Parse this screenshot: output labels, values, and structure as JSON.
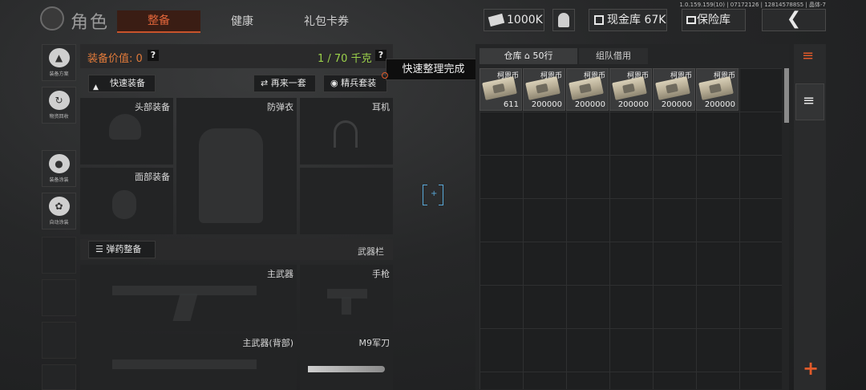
{
  "version_text": "1.0.159.159(10) | 07172126 | 128145788S5 | 晶体-7",
  "header": {
    "title": "角色",
    "tabs": [
      "整备",
      "健康",
      "礼包卡券"
    ],
    "currency_amount": "1000K",
    "cash_vault": "现金库 67K",
    "safe": "保险库",
    "back_icon": "chevron-left-icon"
  },
  "sidebar": {
    "items": [
      {
        "label": "装备方案",
        "icon": "helmet-icon"
      },
      {
        "label": "物资回收",
        "icon": "recycle-icon"
      },
      {
        "label": "装备涂装",
        "icon": "paint-icon"
      },
      {
        "label": "自动涂装",
        "icon": "spray-icon"
      }
    ]
  },
  "equipment": {
    "value_label": "装备价值: 0",
    "weight_label": "1 / 70 千克",
    "help": "?",
    "quick_equip": "快速装备",
    "repeat": "再来一套",
    "elite": "精兵套装",
    "ammo": "弹药整备",
    "weapon_bar": "武器栏",
    "slots": {
      "head": "头部装备",
      "armor": "防弹衣",
      "earphone": "耳机",
      "face": "面部装备",
      "primary": "主武器",
      "pistol": "手枪",
      "primary_back": "主武器(背部)",
      "knife": "M9军刀"
    }
  },
  "tooltip": "快速整理完成",
  "warehouse": {
    "tab_active": "仓库",
    "tab_rows": "50行",
    "tab_team": "组队借用",
    "items": [
      {
        "name": "柯恩币",
        "count": "611"
      },
      {
        "name": "柯恩币",
        "count": "200000"
      },
      {
        "name": "柯恩币",
        "count": "200000"
      },
      {
        "name": "柯恩币",
        "count": "200000"
      },
      {
        "name": "柯恩币",
        "count": "200000"
      },
      {
        "name": "柯恩币",
        "count": "200000"
      }
    ]
  },
  "right_column": {
    "add": "+"
  },
  "colors": {
    "accent": "#e0653a",
    "weight_green": "#9bd14a",
    "bracket_blue": "#58a8d8"
  }
}
